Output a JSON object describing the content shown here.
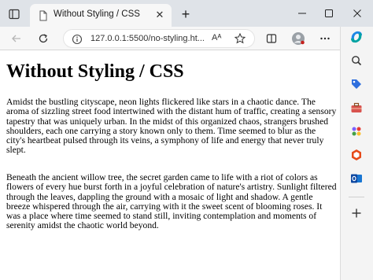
{
  "browser": {
    "tab": {
      "title": "Without Styling / CSS"
    },
    "address_bar": {
      "url": "127.0.0.1:5500/no-styling.ht..."
    },
    "read_aloud_label": "Aᴬ"
  },
  "page": {
    "heading": "Without Styling / CSS",
    "paragraphs": [
      "Amidst the bustling cityscape, neon lights flickered like stars in a chaotic dance. The aroma of sizzling street food intertwined with the distant hum of traffic, creating a sensory tapestry that was uniquely urban. In the midst of this organized chaos, strangers brushed shoulders, each one carrying a story known only to them. Time seemed to blur as the city's heartbeat pulsed through its veins, a symphony of life and energy that never truly slept.",
      "Beneath the ancient willow tree, the secret garden came to life with a riot of colors as flowers of every hue burst forth in a joyful celebration of nature's artistry. Sunlight filtered through the leaves, dappling the ground with a mosaic of light and shadow. A gentle breeze whispered through the air, carrying with it the sweet scent of blooming roses. It was a place where time seemed to stand still, inviting contemplation and moments of serenity amidst the chaotic world beyond."
    ]
  },
  "colors": {
    "titlebar": "#dfe3e8",
    "toolbar": "#f7f7f7",
    "sidebar": "#f4f4f4"
  }
}
